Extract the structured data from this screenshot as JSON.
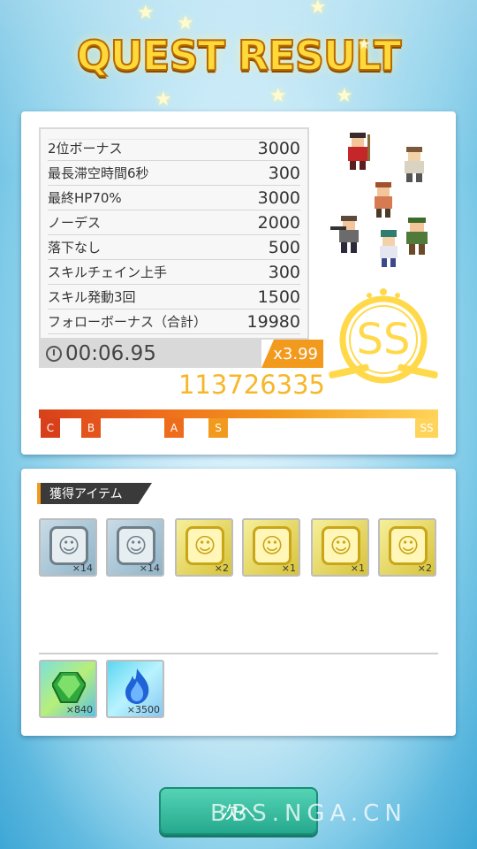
{
  "title": "QUEST RESULT",
  "bonus_list": [
    {
      "label": "2位ボーナス",
      "value": "3000"
    },
    {
      "label": "最長滞空時間6秒",
      "value": "300"
    },
    {
      "label": "最終HP70%",
      "value": "3000"
    },
    {
      "label": "ノーデス",
      "value": "2000"
    },
    {
      "label": "落下なし",
      "value": "500"
    },
    {
      "label": "スキルチェイン上手",
      "value": "300"
    },
    {
      "label": "スキル発動3回",
      "value": "1500"
    },
    {
      "label": "フォローボーナス（合計）",
      "value": "19980"
    }
  ],
  "timer": "00:06.95",
  "multiplier": "x3.99",
  "score": "113726335",
  "rank": {
    "grade": "SS",
    "progress": 1.0,
    "marks": [
      "C",
      "B",
      "A",
      "S",
      "SS"
    ]
  },
  "items_header": "獲得アイテム",
  "items": [
    {
      "type": "silver",
      "icon": "silver-coin-icon",
      "qty": "×14"
    },
    {
      "type": "silver",
      "icon": "silver-coin-icon",
      "qty": "×14"
    },
    {
      "type": "gold",
      "icon": "gold-coin-icon",
      "qty": "×2"
    },
    {
      "type": "gold",
      "icon": "gold-coin-icon",
      "qty": "×1"
    },
    {
      "type": "gold",
      "icon": "gold-coin-icon",
      "qty": "×1"
    },
    {
      "type": "gold",
      "icon": "gold-coin-icon",
      "qty": "×2"
    }
  ],
  "rewards": [
    {
      "type": "green",
      "icon": "green-gem-icon",
      "qty": "×840"
    },
    {
      "type": "blue",
      "icon": "blue-flame-icon",
      "qty": "×3500"
    }
  ],
  "next_button": "次へ",
  "watermark": "BBS.NGA.CN",
  "colors": {
    "title": "#ffd93a",
    "score": "#f7b72b",
    "multiplier": "#f29a1e",
    "emblem": "#ffd94a",
    "button": "#25a98e"
  }
}
